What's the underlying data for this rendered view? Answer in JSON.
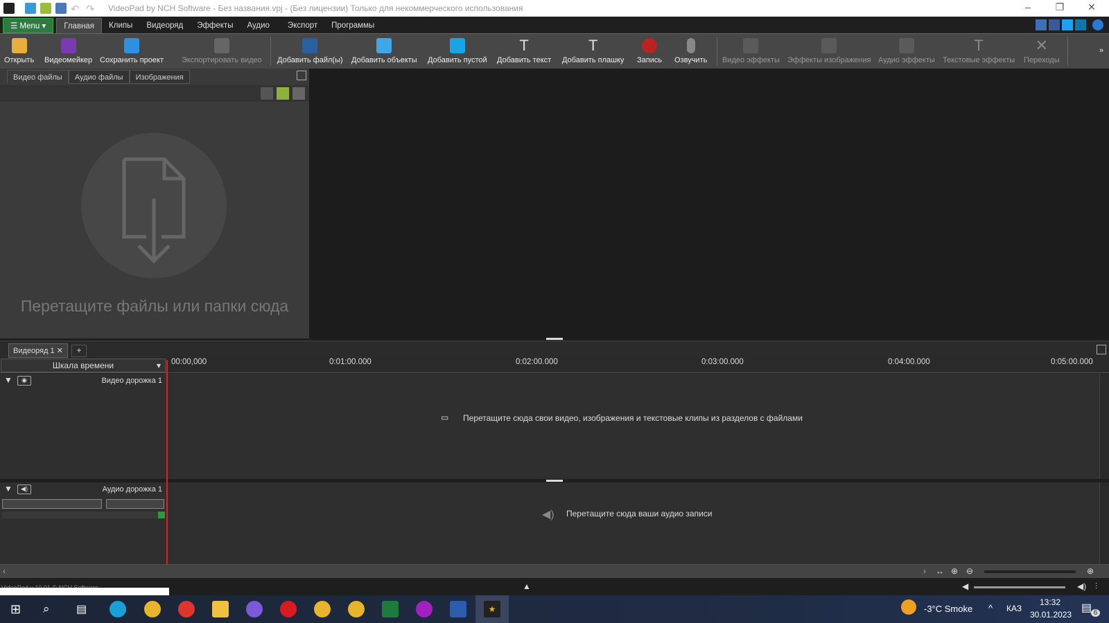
{
  "window": {
    "title": "VideoPad by NCH Software - Без названия.vpj - (Без лицензии) Только для некоммерческого использования"
  },
  "menu": {
    "menu_label": "Menu",
    "tabs": [
      "Главная",
      "Клипы",
      "Видеоряд",
      "Эффекты",
      "Аудио",
      "Экспорт",
      "Программы"
    ]
  },
  "toolbar": {
    "items": [
      "Открыть",
      "Видеомейкер",
      "Сохранить проект",
      "Экспортировать видео",
      "Добавить файл(ы)",
      "Добавить объекты",
      "Добавить пустой",
      "Добавить текст",
      "Добавить плашку",
      "Запись",
      "Озвучить",
      "Видео эффекты",
      "Эффекты изображения",
      "Аудио эффекты",
      "Текстовые эффекты",
      "Переходы"
    ]
  },
  "files": {
    "tabs": [
      "Видео файлы",
      "Аудио файлы",
      "Изображения"
    ],
    "drop_text": "Перетащите файлы или папки сюда"
  },
  "timeline": {
    "sequence_tab": "Видеоряд 1",
    "add_tab": "+",
    "scale_label": "Шкала времени",
    "ticks": [
      "00:00,000",
      "0:01:00.000",
      "0:02:00.000",
      "0:03:00.000",
      "0:04:00.000",
      "0:05:00.000"
    ],
    "video_track": "Видео дорожка 1",
    "video_hint": "Перетащите сюда свои видео, изображения и текстовые клипы из разделов с файлами",
    "audio_track": "Аудио дорожка 1",
    "audio_hint": "Перетащите сюда ваши аудио записи"
  },
  "status": {
    "text": "VideoPad v 10.01 © NCH Software"
  },
  "taskbar": {
    "weather": "-3°C  Smoke",
    "lang": "КАЗ",
    "time": "13:32",
    "date": "30.01.2023",
    "notif": "6"
  }
}
